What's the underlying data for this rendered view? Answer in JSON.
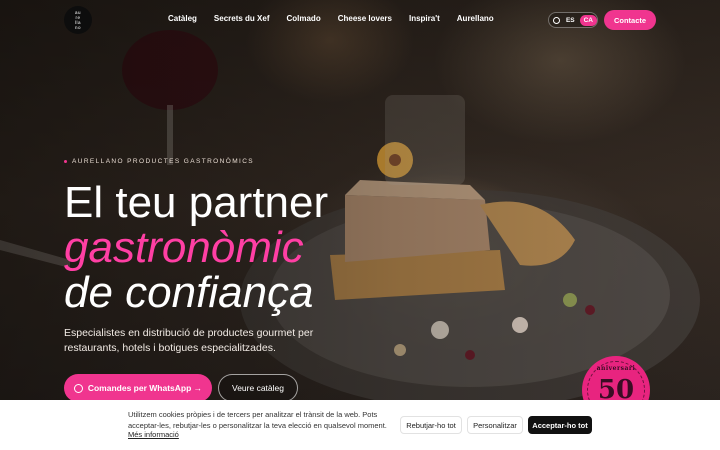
{
  "logo": {
    "lines": [
      "au",
      "re",
      "lla",
      "no"
    ]
  },
  "nav": {
    "items": [
      {
        "label": "Catàleg"
      },
      {
        "label": "Secrets du Xef"
      },
      {
        "label": "Colmado"
      },
      {
        "label": "Cheese lovers"
      },
      {
        "label": "Inspira't"
      },
      {
        "label": "Aurellano"
      }
    ],
    "lang": {
      "es": "ES",
      "ca": "CA",
      "active": "CA"
    },
    "contact_label": "Contacte"
  },
  "hero": {
    "eyebrow": "AURELLANO PRODUCTES GASTRONÒMICS",
    "title_line1": "El teu partner",
    "title_line2": "gastronòmic",
    "title_line3": "de confiança",
    "subtitle": "Especialistes en distribució de productes gourmet per restaurants, hotels i botigues especialitzades.",
    "whatsapp_label": "Comandes per WhatsApp →",
    "catalog_label": "Veure catàleg",
    "badge": {
      "number": "50",
      "word": "aniversari"
    }
  },
  "colors": {
    "accent": "#f0358f",
    "badge": "#e8247f",
    "cookie_bg": "#ffffff"
  },
  "cookie": {
    "text": "Utilitzem cookies pròpies i de tercers per analitzar el trànsit de la web. Pots acceptar-les, rebutjar-les o personalitzar la teva elecció en qualsevol moment.",
    "more_info": "Més informació",
    "reject_label": "Rebutjar-ho tot",
    "customize_label": "Personalitzar",
    "accept_label": "Acceptar-ho tot"
  }
}
